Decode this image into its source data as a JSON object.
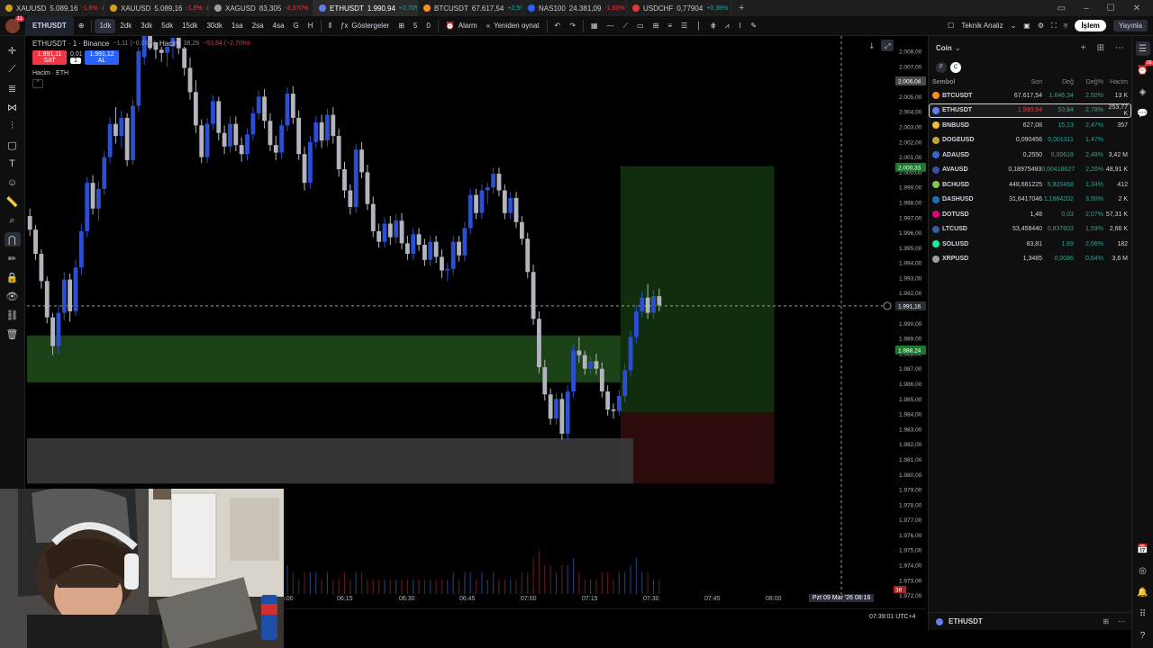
{
  "browser_tabs": [
    {
      "name": "XAUUSD",
      "price": "5.089,16",
      "change": "-1,6%",
      "dir": "down",
      "color": "#d4a017"
    },
    {
      "name": "XAUUSD",
      "price": "5.089,16",
      "change": "-1,6%",
      "dir": "down",
      "color": "#d4a017"
    },
    {
      "name": "XAGUSD",
      "price": "83,305",
      "change": "-3,370%",
      "dir": "down",
      "color": "#9e9e9e"
    },
    {
      "name": "ETHUSDT",
      "price": "1.990,94",
      "change": "+2,70%",
      "dir": "up",
      "color": "#627eea",
      "active": true
    },
    {
      "name": "BTCUSDT",
      "price": "67.617,54",
      "change": "+2,5%",
      "dir": "up",
      "color": "#f7931a"
    },
    {
      "name": "NAS100",
      "price": "24.381,09",
      "change": "-1,60%",
      "dir": "down",
      "color": "#2962ff"
    },
    {
      "name": "USDCHF",
      "price": "0,77904",
      "change": "+0,38%",
      "dir": "up",
      "color": "#e53935"
    }
  ],
  "toolbar": {
    "avatar_badge": "11",
    "symbol": "ETHUSDT",
    "intervals": [
      "1dk",
      "2dk",
      "3dk",
      "5dk",
      "15dk",
      "30dk",
      "1sa",
      "2sa",
      "4sa",
      "G",
      "H"
    ],
    "selected_interval": "1dk",
    "indicators_label": "Göstergeler",
    "counter_a": "5",
    "counter_b": "0",
    "alarm_label": "Alarm",
    "replay_label": "Yeniden oynat",
    "technical_label": "Teknik Analiz",
    "trade_label": "İşlem",
    "publish_label": "Yayınla"
  },
  "legend": {
    "title": "ETHUSDT · 1 · Binance",
    "change": "−1,11 (−0,06%)",
    "volume_label": "Hacim",
    "volume_value": "38,29",
    "volume_change": "−53,84 (−2,70%)",
    "sell_price": "1.991,11",
    "sell_label": "SAT",
    "spread": "0,01",
    "qty": "1",
    "buy_price": "1.991,12",
    "buy_label": "AL",
    "pane_label": "Hacim · ETH"
  },
  "chart_data": {
    "type": "candlestick",
    "symbol": "ETHUSDT",
    "interval": "1",
    "exchange": "Binance",
    "y_ticks": [
      "2.008,00",
      "2.007,00",
      "2.006,00",
      "2.005,00",
      "2.004,00",
      "2.003,00",
      "2.002,00",
      "2.001,00",
      "2.000,00",
      "1.999,00",
      "1.998,00",
      "1.997,00",
      "1.996,00",
      "1.995,00",
      "1.994,00",
      "1.993,00",
      "1.992,00",
      "1.991,00",
      "1.990,00",
      "1.989,00",
      "1.988,00",
      "1.987,00",
      "1.986,00",
      "1.985,00",
      "1.984,00",
      "1.983,00",
      "1.982,00",
      "1.981,00",
      "1.980,00",
      "1.979,00",
      "1.978,00",
      "1.977,00",
      "1.976,00",
      "1.975,00",
      "1.974,00",
      "1.973,00",
      "1.972,00"
    ],
    "ylim": [
      1971.5,
      2008.3
    ],
    "x_ticks": [
      "06:00",
      "06:15",
      "06:30",
      "06:45",
      "07:00",
      "07:15",
      "07:30",
      "07:45",
      "08:00"
    ],
    "crosshair_time": "Pzt 09 Mar '26   08:16",
    "price_labels": [
      {
        "text": "2.006,04",
        "value": 2006.04,
        "kind": "gray"
      },
      {
        "text": "2.000,33",
        "value": 2000.33,
        "kind": "green"
      },
      {
        "text": "1.991,16",
        "value": 1991.16,
        "kind": "crosshair"
      },
      {
        "text": "1.988,24",
        "value": 1988.24,
        "kind": "green"
      }
    ],
    "volume_marker": "38",
    "zones": [
      {
        "kind": "demand",
        "y_top": 1989.2,
        "y_bottom": 1986.1,
        "t_start": 0,
        "t_end": 0.695
      },
      {
        "kind": "target",
        "y_top": 2000.4,
        "y_bottom": 1984.1,
        "t_start": 0.695,
        "t_end": 0.875
      },
      {
        "kind": "stop",
        "y_top": 1984.1,
        "y_bottom": 1979.4,
        "t_start": 0.695,
        "t_end": 0.875
      },
      {
        "kind": "gray",
        "y_top": 1982.4,
        "y_bottom": 1979.4,
        "t_start": 0,
        "t_end": 0.71
      }
    ],
    "candles": [
      [
        1997.1,
        1997.6,
        1995.8,
        1996.2
      ],
      [
        1996.2,
        1996.5,
        1994.2,
        1994.6
      ],
      [
        1994.6,
        1994.9,
        1992.3,
        1992.8
      ],
      [
        1992.8,
        1993.1,
        1990.0,
        1990.4
      ],
      [
        1990.4,
        1990.7,
        1987.9,
        1988.5
      ],
      [
        1988.5,
        1991.2,
        1988.0,
        1990.7
      ],
      [
        1990.7,
        1993.4,
        1990.2,
        1992.9
      ],
      [
        1992.9,
        1993.3,
        1990.1,
        1990.8
      ],
      [
        1990.8,
        1994.2,
        1990.5,
        1993.7
      ],
      [
        1993.7,
        1996.6,
        1993.2,
        1996.1
      ],
      [
        1996.1,
        1999.7,
        1995.7,
        1999.3
      ],
      [
        1999.3,
        1999.8,
        1997.2,
        1997.6
      ],
      [
        1997.6,
        1999.4,
        1996.8,
        1998.9
      ],
      [
        1998.9,
        2001.4,
        1998.5,
        2001.0
      ],
      [
        2001.0,
        2003.6,
        2000.6,
        2003.2
      ],
      [
        2003.2,
        2004.3,
        2001.9,
        2002.4
      ],
      [
        2002.4,
        2004.1,
        2001.6,
        2003.6
      ],
      [
        2003.6,
        2003.9,
        2000.4,
        2000.8
      ],
      [
        2000.8,
        2004.8,
        2000.5,
        2004.4
      ],
      [
        2004.4,
        2008.4,
        2004.0,
        2008.0
      ],
      [
        2008.0,
        2010.0,
        2007.1,
        2009.4
      ],
      [
        2009.4,
        2010.0,
        2008.1,
        2008.6
      ],
      [
        2008.6,
        2010.0,
        2007.5,
        2008.1
      ],
      [
        2008.1,
        2010.0,
        2007.3,
        2007.9
      ],
      [
        2007.9,
        2010.0,
        2007.0,
        2008.3
      ],
      [
        2008.3,
        2010.0,
        2007.5,
        2008.9
      ],
      [
        2008.9,
        2010.0,
        2007.8,
        2008.2
      ],
      [
        2008.2,
        2008.7,
        2006.4,
        2006.9
      ],
      [
        2006.9,
        2007.6,
        2004.8,
        2005.3
      ],
      [
        2005.3,
        2006.1,
        2002.6,
        2003.1
      ],
      [
        2003.1,
        2003.5,
        2000.6,
        2001.0
      ],
      [
        2001.0,
        2003.6,
        2000.6,
        2003.2
      ],
      [
        2003.2,
        2005.1,
        2002.8,
        2004.7
      ],
      [
        2004.7,
        2005.0,
        2002.1,
        2002.6
      ],
      [
        2002.6,
        2003.1,
        2001.2,
        2001.7
      ],
      [
        2001.7,
        2003.7,
        2001.3,
        2003.2
      ],
      [
        2003.2,
        2003.7,
        2001.4,
        2001.8
      ],
      [
        2001.8,
        2002.3,
        2000.7,
        2001.2
      ],
      [
        2001.2,
        2002.9,
        2000.8,
        2002.5
      ],
      [
        2002.5,
        2004.3,
        2002.1,
        2003.9
      ],
      [
        2003.9,
        2005.4,
        2003.5,
        2005.0
      ],
      [
        2005.0,
        2005.5,
        2002.9,
        2003.4
      ],
      [
        2003.4,
        2003.9,
        2001.4,
        2001.8
      ],
      [
        2001.8,
        2002.4,
        2000.8,
        2001.3
      ],
      [
        2001.3,
        2003.5,
        2000.9,
        2003.1
      ],
      [
        2003.1,
        2005.6,
        2002.7,
        2005.2
      ],
      [
        2005.2,
        2005.7,
        2003.2,
        2003.6
      ],
      [
        2003.6,
        2004.1,
        2000.8,
        2001.2
      ],
      [
        2001.2,
        2001.7,
        1998.8,
        1999.3
      ],
      [
        1999.3,
        2002.4,
        1998.9,
        2002.0
      ],
      [
        2002.0,
        2003.7,
        2001.6,
        2003.3
      ],
      [
        2003.3,
        2003.8,
        2001.6,
        2002.1
      ],
      [
        2002.1,
        2004.2,
        2001.7,
        2003.8
      ],
      [
        2003.8,
        2004.3,
        2001.9,
        2002.4
      ],
      [
        2002.4,
        2002.9,
        1999.7,
        2000.2
      ],
      [
        2000.2,
        2000.7,
        1998.3,
        1998.8
      ],
      [
        1998.8,
        1999.2,
        1997.2,
        1997.7
      ],
      [
        1997.7,
        2001.9,
        1997.3,
        2001.5
      ],
      [
        2001.5,
        2002.0,
        1999.6,
        2000.0
      ],
      [
        2000.0,
        2000.5,
        1997.5,
        1997.9
      ],
      [
        1997.9,
        1998.4,
        1995.7,
        1996.1
      ],
      [
        1996.1,
        1996.6,
        1995.0,
        1995.4
      ],
      [
        1995.4,
        1997.0,
        1995.0,
        1996.6
      ],
      [
        1996.6,
        1997.1,
        1995.2,
        1995.7
      ],
      [
        1995.7,
        1997.2,
        1995.3,
        1996.8
      ],
      [
        1996.8,
        1997.3,
        1994.9,
        1995.3
      ],
      [
        1995.3,
        1995.8,
        1994.2,
        1994.6
      ],
      [
        1994.6,
        1996.3,
        1994.2,
        1995.9
      ],
      [
        1995.9,
        1996.3,
        1994.8,
        1995.2
      ],
      [
        1995.2,
        1995.6,
        1993.8,
        1994.2
      ],
      [
        1994.2,
        1995.8,
        1993.8,
        1995.4
      ],
      [
        1995.4,
        1995.8,
        1994.0,
        1994.4
      ],
      [
        1994.4,
        1994.9,
        1993.0,
        1993.5
      ],
      [
        1993.5,
        1994.0,
        1992.8,
        1993.6
      ],
      [
        1993.6,
        1995.8,
        1993.2,
        1995.4
      ],
      [
        1995.4,
        1995.8,
        1994.1,
        1994.5
      ],
      [
        1994.5,
        1996.7,
        1994.1,
        1996.3
      ],
      [
        1996.3,
        1998.9,
        1995.9,
        1998.5
      ],
      [
        1998.5,
        1998.9,
        1996.9,
        1997.3
      ],
      [
        1997.3,
        1999.2,
        1996.9,
        1998.8
      ],
      [
        1998.8,
        1999.3,
        1997.9,
        1999.0
      ],
      [
        1999.0,
        2000.3,
        1998.6,
        1999.9
      ],
      [
        1999.9,
        2000.3,
        1998.4,
        1998.8
      ],
      [
        1998.8,
        1999.2,
        1996.9,
        1997.3
      ],
      [
        1997.3,
        1998.7,
        1996.9,
        1998.3
      ],
      [
        1998.3,
        1998.7,
        1996.3,
        1996.7
      ],
      [
        1996.7,
        1997.1,
        1995.2,
        1995.6
      ],
      [
        1995.6,
        1996.0,
        1993.0,
        1993.4
      ],
      [
        1993.4,
        1993.9,
        1989.9,
        1990.3
      ],
      [
        1990.3,
        1990.8,
        1986.7,
        1987.1
      ],
      [
        1987.1,
        1987.6,
        1984.9,
        1985.3
      ],
      [
        1985.3,
        1985.7,
        1983.3,
        1983.7
      ],
      [
        1983.7,
        1985.4,
        1983.3,
        1985.0
      ],
      [
        1985.0,
        1985.4,
        1982.3,
        1982.7
      ],
      [
        1982.7,
        1985.9,
        1982.3,
        1985.5
      ],
      [
        1985.5,
        1988.6,
        1985.1,
        1988.2
      ],
      [
        1988.2,
        1989.1,
        1987.4,
        1987.9
      ],
      [
        1987.9,
        1988.2,
        1986.6,
        1987.0
      ],
      [
        1987.0,
        1987.9,
        1986.6,
        1987.5
      ],
      [
        1987.5,
        1988.0,
        1986.6,
        1987.0
      ],
      [
        1987.0,
        1987.4,
        1985.1,
        1985.5
      ],
      [
        1985.5,
        1985.9,
        1983.9,
        1984.3
      ],
      [
        1984.3,
        1984.7,
        1983.7,
        1984.2
      ],
      [
        1984.2,
        1985.6,
        1983.9,
        1985.2
      ],
      [
        1985.2,
        1987.3,
        1984.8,
        1986.9
      ],
      [
        1986.9,
        1989.5,
        1986.5,
        1989.1
      ],
      [
        1989.1,
        1991.2,
        1988.7,
        1990.8
      ],
      [
        1990.8,
        1992.1,
        1990.4,
        1991.7
      ],
      [
        1991.7,
        1992.6,
        1990.3,
        1990.7
      ],
      [
        1990.7,
        1992.2,
        1990.3,
        1991.8
      ],
      [
        1991.8,
        1992.3,
        1990.8,
        1991.2
      ]
    ],
    "volumes": [
      2,
      3,
      3,
      4,
      5,
      3,
      3,
      2,
      3,
      4,
      6,
      3,
      3,
      4,
      5,
      3,
      3,
      3,
      4,
      7,
      8,
      5,
      4,
      4,
      4,
      5,
      4,
      3,
      3,
      3,
      3,
      3,
      4,
      3,
      2,
      3,
      2,
      2,
      3,
      3,
      4,
      3,
      2,
      2,
      3,
      4,
      3,
      2,
      3,
      3,
      3,
      2,
      3,
      2,
      2,
      3,
      2,
      3,
      3,
      2,
      2,
      2,
      2,
      2,
      2,
      2,
      2,
      2,
      2,
      2,
      2,
      2,
      2,
      2,
      3,
      2,
      3,
      3,
      2,
      3,
      2,
      3,
      2,
      2,
      2,
      2,
      3,
      3,
      5,
      6,
      4,
      4,
      3,
      4,
      4,
      5,
      3,
      2,
      2,
      2,
      3,
      3,
      2,
      3,
      3,
      4,
      5,
      3,
      3,
      2,
      2
    ]
  },
  "watchlist": {
    "title": "Coin",
    "filter_f": "F",
    "filter_c": "C",
    "columns": {
      "symbol": "Sembol",
      "last": "Son",
      "change": "Değ",
      "pct": "Değ%",
      "volume": "Hacim"
    },
    "rows": [
      {
        "symbol": "BTCUSDT",
        "last": "67.617,54",
        "change": "1.646,34",
        "pct": "2,50%",
        "volume": "13 K",
        "dir": "up",
        "color": "#f7931a"
      },
      {
        "symbol": "ETHUSDT",
        "last": "1.990,94",
        "change": "53,84",
        "pct": "2,78%",
        "volume": "253,77 K",
        "dir": "up",
        "last_dir": "down",
        "color": "#627eea",
        "selected": true
      },
      {
        "symbol": "BNBUSD",
        "last": "627,08",
        "change": "15,13",
        "pct": "2,47%",
        "volume": "357",
        "dir": "up",
        "color": "#f3ba2f"
      },
      {
        "symbol": "DOGEUSD",
        "last": "0,090456",
        "change": "0,001311",
        "pct": "1,47%",
        "volume": "",
        "dir": "up",
        "color": "#c2a633"
      },
      {
        "symbol": "ADAUSD",
        "last": "0,2550",
        "change": "0,00618",
        "pct": "2,48%",
        "volume": "3,42 M",
        "dir": "up",
        "color": "#3468d1"
      },
      {
        "symbol": "AVAUSD",
        "last": "0,18975493",
        "change": "0,00418627",
        "pct": "2,26%",
        "volume": "48,91 K",
        "dir": "up",
        "color": "#3b4fa8"
      },
      {
        "symbol": "BCHUSD",
        "last": "448,661225",
        "change": "5,920458",
        "pct": "1,34%",
        "volume": "412",
        "dir": "up",
        "color": "#8dc351"
      },
      {
        "symbol": "DASHUSD",
        "last": "31,6417046",
        "change": "1,1884202",
        "pct": "3,90%",
        "volume": "2 K",
        "dir": "up",
        "color": "#1c75bc"
      },
      {
        "symbol": "DOTUSD",
        "last": "1,48",
        "change": "0,03",
        "pct": "2,07%",
        "volume": "57,31 K",
        "dir": "up",
        "color": "#e6007a"
      },
      {
        "symbol": "LTCUSD",
        "last": "53,458440",
        "change": "0,837603",
        "pct": "1,59%",
        "volume": "2,66 K",
        "dir": "up",
        "color": "#345d9d"
      },
      {
        "symbol": "SOLUSD",
        "last": "83,81",
        "change": "1,69",
        "pct": "2,06%",
        "volume": "182",
        "dir": "up",
        "color": "#14f195"
      },
      {
        "symbol": "XRPUSD",
        "last": "1,3485",
        "change": "0,0086",
        "pct": "0,64%",
        "volume": "3,6 M",
        "dir": "up",
        "color": "#9e9e9e"
      }
    ],
    "bottom_symbol": "ETHUSDT"
  },
  "rightrail_badge": "26",
  "clock": "07:39:01 UTC+4"
}
